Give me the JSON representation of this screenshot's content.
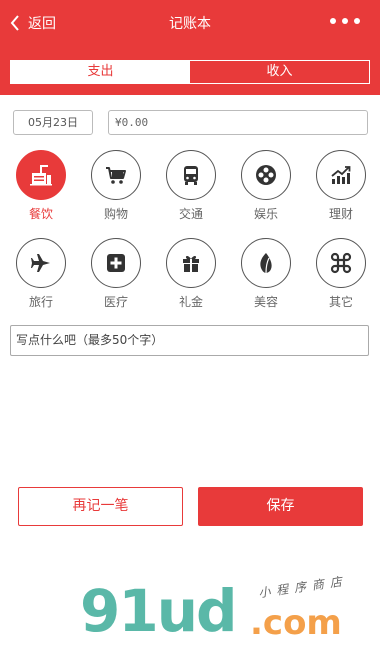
{
  "nav": {
    "back_label": "返回",
    "title": "记账本"
  },
  "tabs": [
    {
      "label": "支出",
      "active": true
    },
    {
      "label": "收入",
      "active": false
    }
  ],
  "form": {
    "date": "05月23日",
    "amount": "¥0.00",
    "note_placeholder": "写点什么吧（最多50个字）"
  },
  "categories": [
    {
      "label": "餐饮",
      "icon": "dining-icon",
      "selected": true
    },
    {
      "label": "购物",
      "icon": "shopping-cart-icon",
      "selected": false
    },
    {
      "label": "交通",
      "icon": "bus-icon",
      "selected": false
    },
    {
      "label": "娱乐",
      "icon": "film-reel-icon",
      "selected": false
    },
    {
      "label": "理财",
      "icon": "trend-chart-icon",
      "selected": false
    },
    {
      "label": "旅行",
      "icon": "airplane-icon",
      "selected": false
    },
    {
      "label": "医疗",
      "icon": "medical-cross-icon",
      "selected": false
    },
    {
      "label": "礼金",
      "icon": "gift-icon",
      "selected": false
    },
    {
      "label": "美容",
      "icon": "leaf-icon",
      "selected": false
    },
    {
      "label": "其它",
      "icon": "command-icon",
      "selected": false
    }
  ],
  "buttons": {
    "again": "再记一笔",
    "save": "保存"
  },
  "watermark": {
    "brand": "91ud",
    "domain": ".com",
    "tagline": "小程序商店"
  },
  "colors": {
    "accent": "#e83a3a",
    "watermark_teal": "#5ab8a8",
    "watermark_orange": "#f4a04a"
  }
}
